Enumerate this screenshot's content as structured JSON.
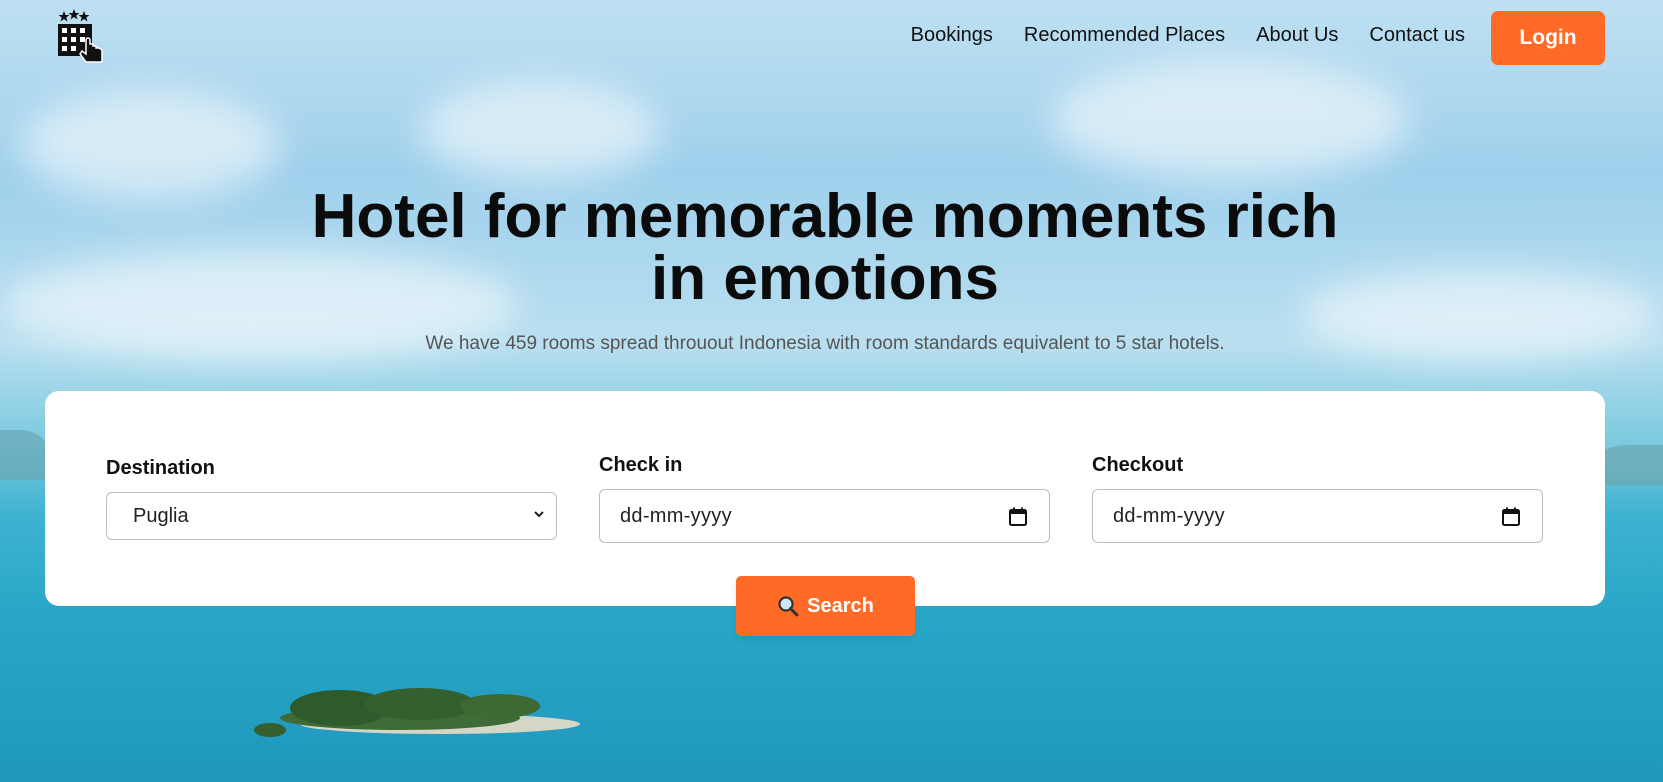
{
  "nav": {
    "logo_icon": "hotel-building-with-stars-and-hand-icon",
    "links": [
      "Bookings",
      "Recommended Places",
      "About Us",
      "Contact us"
    ],
    "login_label": "Login"
  },
  "hero": {
    "title_line1": "Hotel for memorable moments rich",
    "title_line2": "in emotions",
    "subtitle": "We have 459 rooms spread throuout Indonesia with room standards equivalent to 5 star hotels."
  },
  "search": {
    "destination": {
      "label": "Destination",
      "value": "Puglia"
    },
    "checkin": {
      "label": "Check in",
      "placeholder": "dd-mm-yyyy"
    },
    "checkout": {
      "label": "Checkout",
      "placeholder": "dd-mm-yyyy"
    },
    "button_label": "Search",
    "button_icon": "magnifying-glass-icon"
  },
  "colors": {
    "accent": "#ff6a26",
    "text": "#111111",
    "card": "#ffffff"
  }
}
